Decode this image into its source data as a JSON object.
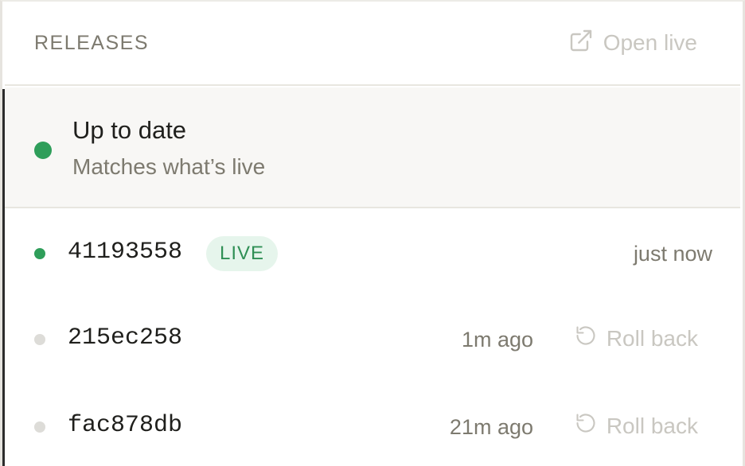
{
  "header": {
    "title": "RELEASES",
    "open_live_label": "Open live",
    "open_live_icon": "external-link-icon"
  },
  "status": {
    "title": "Up to date",
    "subtitle": "Matches what’s live",
    "dot_color": "#2f9e5a"
  },
  "releases": [
    {
      "hash": "41193558",
      "badge": "LIVE",
      "time": "just now",
      "is_live": true,
      "dot_color": "#2f9e5a"
    },
    {
      "hash": "215ec258",
      "time": "1m ago",
      "action": "Roll back",
      "is_live": false,
      "dot_color": "#dddcd8"
    },
    {
      "hash": "fac878db",
      "time": "21m ago",
      "action": "Roll back",
      "is_live": false,
      "dot_color": "#dddcd8"
    }
  ],
  "colors": {
    "accent_green": "#2f9e5a",
    "badge_bg": "#e6f5ec",
    "muted_text": "#7d7a6f",
    "disabled_text": "#c9c7c1"
  }
}
